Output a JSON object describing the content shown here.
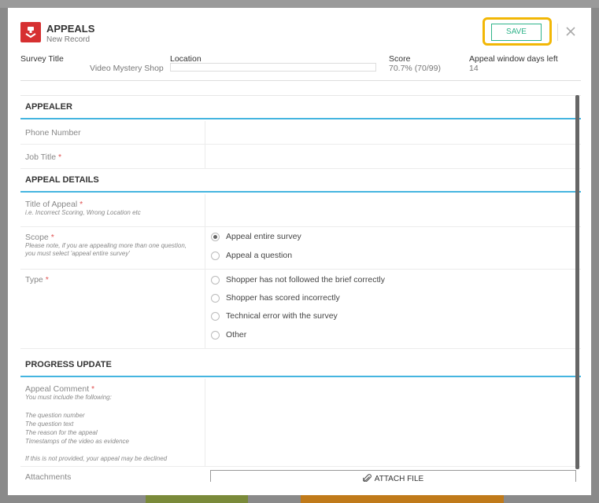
{
  "header": {
    "title": "APPEALS",
    "subtitle": "New Record",
    "save_label": "SAVE",
    "icon": "appeals-app-icon",
    "accent_color": "#d63031",
    "highlight_color": "#f2b705"
  },
  "meta": {
    "survey_title_label": "Survey Title",
    "survey_title_value": "Video Mystery Shop",
    "location_label": "Location",
    "location_value": "",
    "score_label": "Score",
    "score_value": "70.7% (70/99)",
    "window_label": "Appeal window days left",
    "window_value": "14"
  },
  "appealer": {
    "heading": "APPEALER",
    "phone_label": "Phone Number",
    "job_title_label": "Job Title",
    "required_mark": "*"
  },
  "appeal_details": {
    "heading": "APPEAL DETAILS",
    "title_label": "Title of Appeal",
    "title_hint": "i.e. Incorrect Scoring, Wrong Location etc",
    "scope_label": "Scope",
    "scope_hint": "Please note, if you are appealing more than one question, you must select 'appeal entire survey'",
    "scope_options": [
      "Appeal entire survey",
      "Appeal a question"
    ],
    "scope_selected": "Appeal entire survey",
    "type_label": "Type",
    "type_options": [
      "Shopper has not followed the brief correctly",
      "Shopper has scored incorrectly",
      "Technical error with the survey",
      "Other"
    ]
  },
  "progress_update": {
    "heading": "PROGRESS UPDATE",
    "comment_label": "Appeal Comment",
    "comment_hint_intro": "You must include the following:",
    "comment_hint_items": [
      "The question number",
      "The question text",
      "The reason for the appeal",
      "Timestamps of the video as evidence"
    ],
    "comment_hint_footer": "If this is not provided, your appeal may be declined",
    "attachments_label": "Attachments",
    "attach_button": "ATTACH FILE"
  },
  "colors": {
    "section_line": "#45b5e0",
    "save_green": "#2fb38a",
    "required_red": "#e05252"
  }
}
